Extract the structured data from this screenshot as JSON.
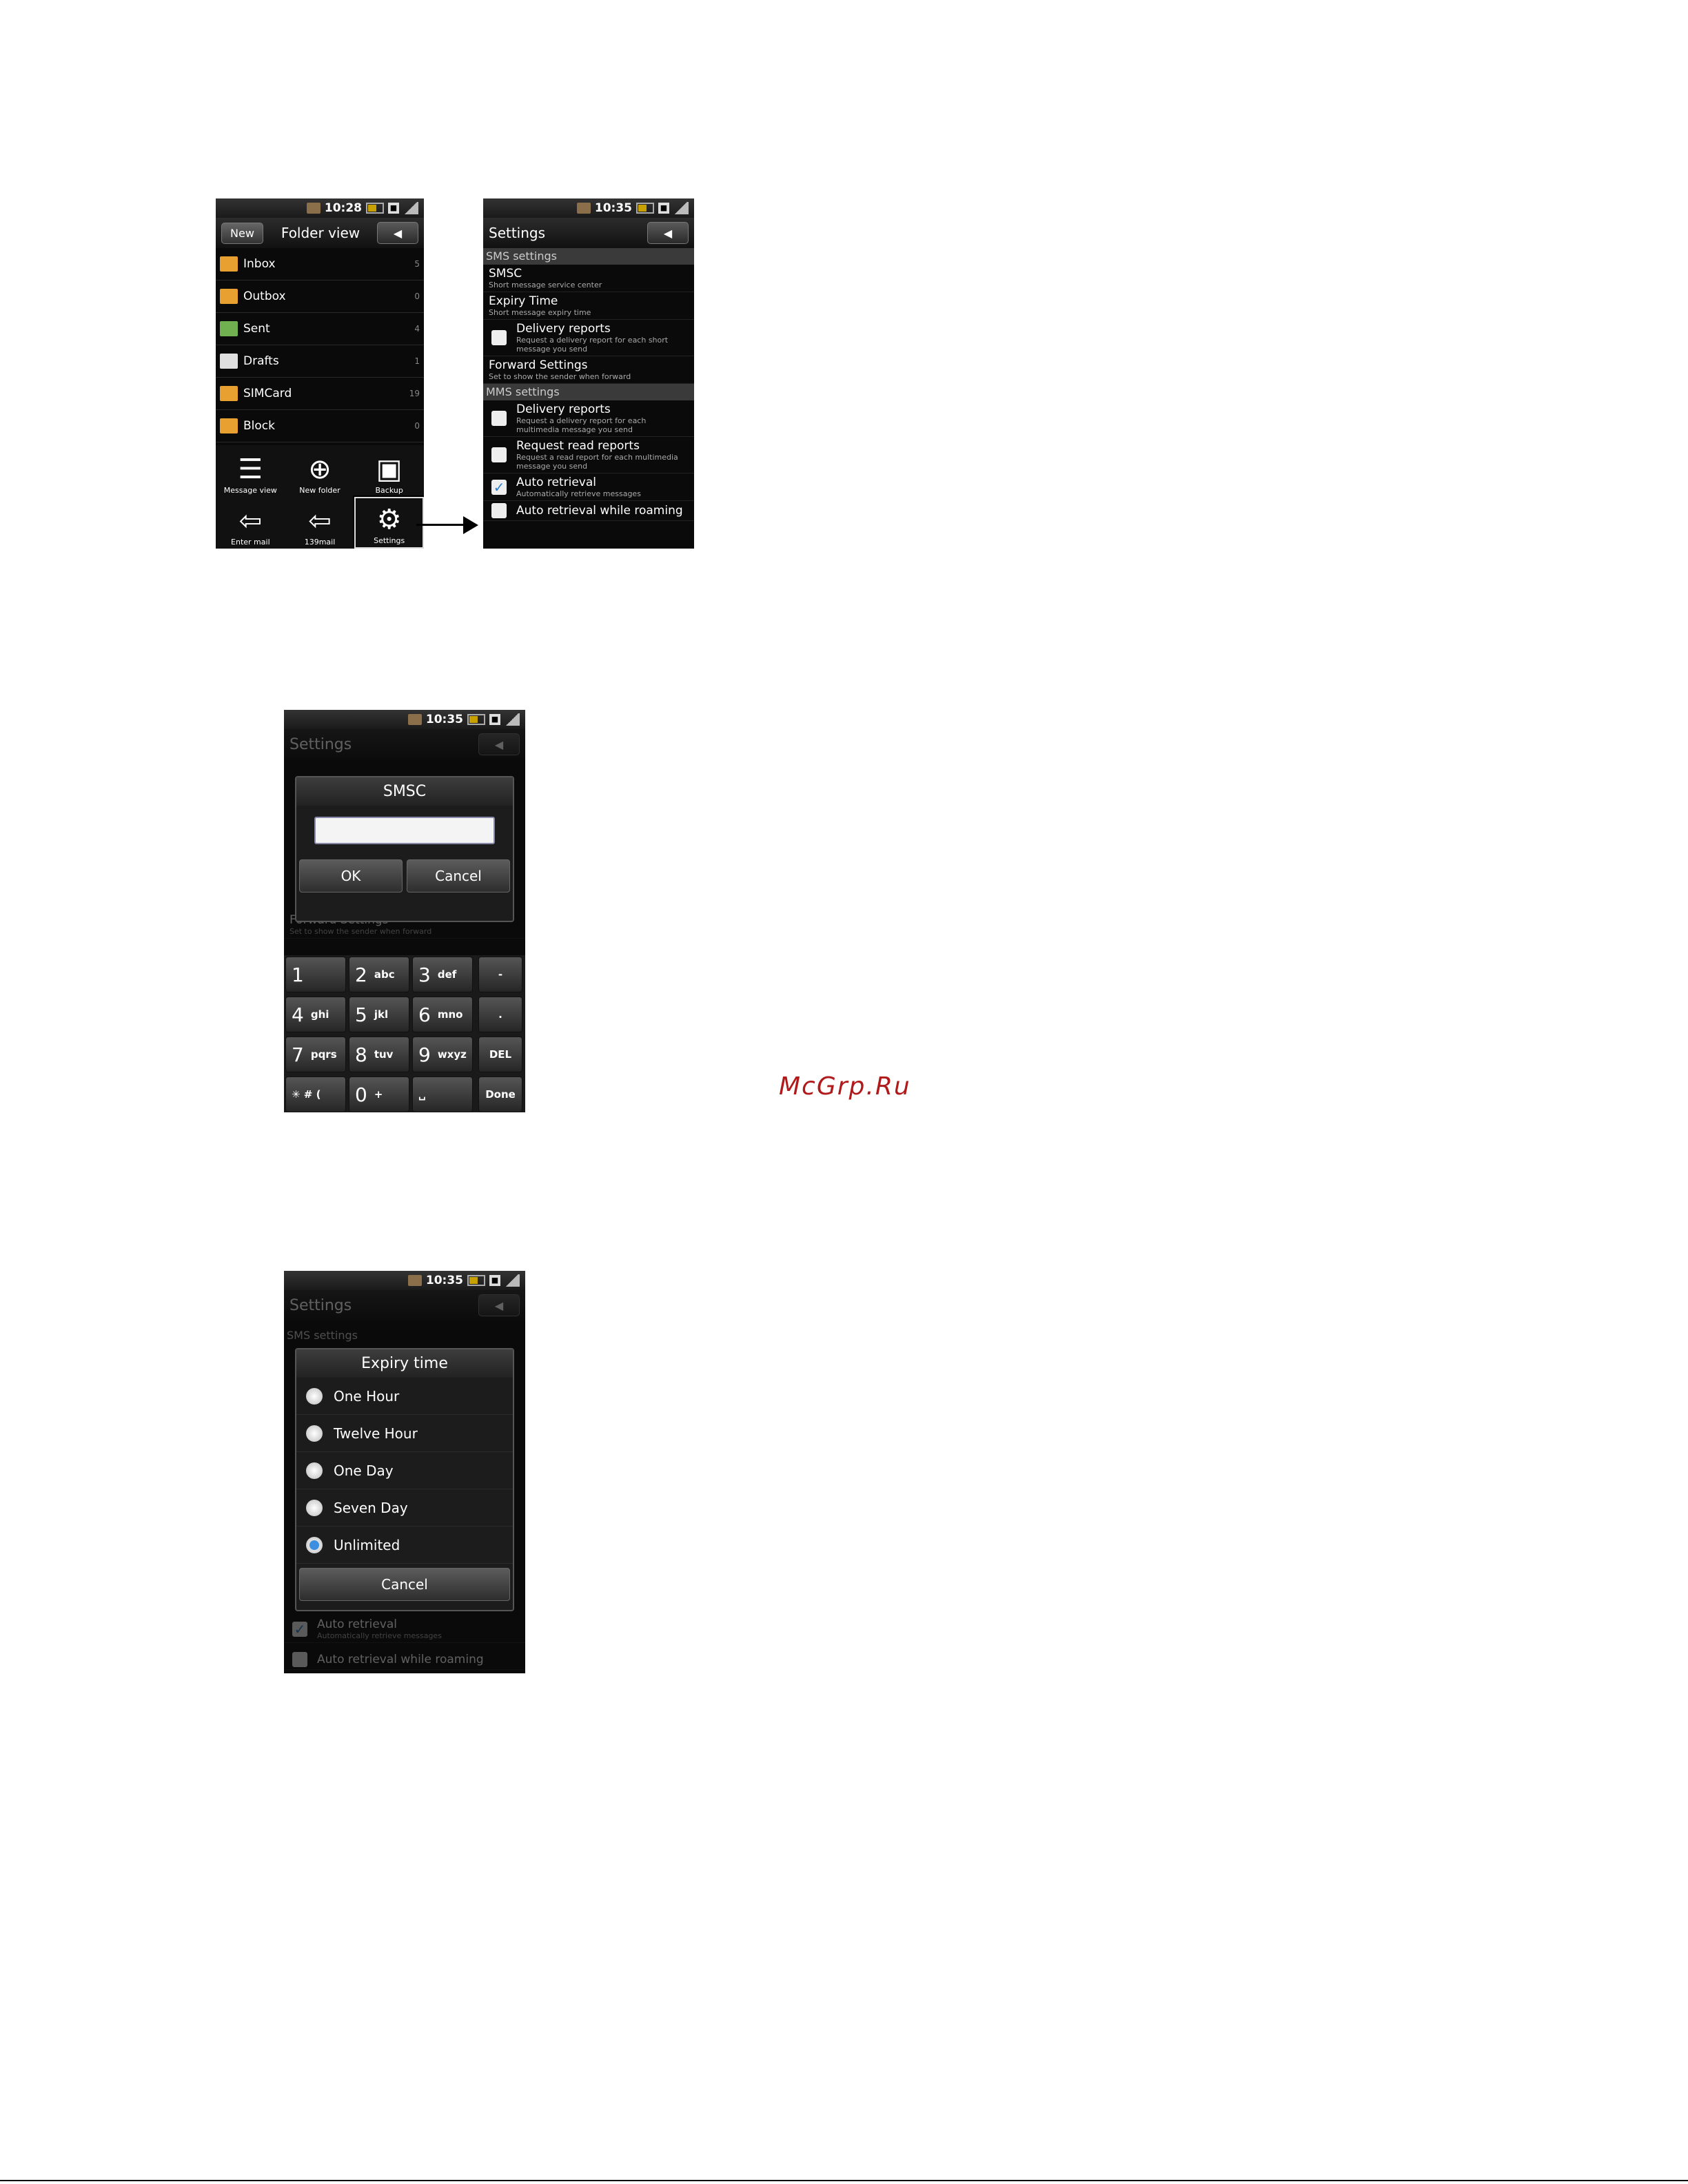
{
  "status_times": {
    "folder": "10:28",
    "settings": "10:35",
    "smsc": "10:35",
    "expiry": "10:35"
  },
  "folder_view": {
    "new_button": "New",
    "title": "Folder view",
    "folders": [
      {
        "name": "Inbox",
        "count": "5",
        "color": "#e8a030"
      },
      {
        "name": "Outbox",
        "count": "0",
        "color": "#e8a030"
      },
      {
        "name": "Sent",
        "count": "4",
        "color": "#70b050"
      },
      {
        "name": "Drafts",
        "count": "1",
        "color": "#e0e0e0"
      },
      {
        "name": "SIMCard",
        "count": "19",
        "color": "#e8a030"
      },
      {
        "name": "Block",
        "count": "0",
        "color": "#e8a030"
      }
    ],
    "menu": [
      {
        "label": "Message view",
        "icon": "list-icon"
      },
      {
        "label": "New folder",
        "icon": "plus-icon"
      },
      {
        "label": "Backup",
        "icon": "save-icon"
      },
      {
        "label": "Enter mail",
        "icon": "mail-enter-icon"
      },
      {
        "label": "139mail",
        "icon": "mail-enter-icon"
      },
      {
        "label": "Settings",
        "icon": "gear-icon"
      }
    ]
  },
  "settings": {
    "title": "Settings",
    "sms_header": "SMS settings",
    "smsc_title": "SMSC",
    "smsc_sub": "Short message service center",
    "expiry_title": "Expiry Time",
    "expiry_sub": "Short message expiry time",
    "sms_delivery_title": "Delivery reports",
    "sms_delivery_sub": "Request a delivery report for each short message you send",
    "forward_title": "Forward Settings",
    "forward_sub": "Set to show the sender when forward",
    "mms_header": "MMS settings",
    "mms_delivery_title": "Delivery reports",
    "mms_delivery_sub": "Request a delivery report for each multimedia message you send",
    "read_title": "Request read reports",
    "read_sub": "Request a read report for each multimedia message you send",
    "auto_title": "Auto retrieval",
    "auto_sub": "Automatically retrieve messages",
    "roaming_title": "Auto retrieval while roaming"
  },
  "smsc_dialog": {
    "title": "SMSC",
    "input_value": "",
    "ok": "OK",
    "cancel": "Cancel"
  },
  "keypad": {
    "rows": [
      [
        {
          "n": "1",
          "l": ""
        },
        {
          "n": "2",
          "l": "abc"
        },
        {
          "n": "3",
          "l": "def"
        },
        {
          "n": "",
          "l": "-"
        }
      ],
      [
        {
          "n": "4",
          "l": "ghi"
        },
        {
          "n": "5",
          "l": "jkl"
        },
        {
          "n": "6",
          "l": "mno"
        },
        {
          "n": "",
          "l": "."
        }
      ],
      [
        {
          "n": "7",
          "l": "pqrs"
        },
        {
          "n": "8",
          "l": "tuv"
        },
        {
          "n": "9",
          "l": "wxyz"
        },
        {
          "n": "",
          "l": "DEL"
        }
      ],
      [
        {
          "n": "",
          "l": "✳ # ("
        },
        {
          "n": "0",
          "l": "+"
        },
        {
          "n": "",
          "l": "␣"
        },
        {
          "n": "",
          "l": "Done"
        }
      ]
    ]
  },
  "expiry_dialog": {
    "title": "Expiry time",
    "options": [
      {
        "label": "One Hour",
        "selected": false
      },
      {
        "label": "Twelve Hour",
        "selected": false
      },
      {
        "label": "One Day",
        "selected": false
      },
      {
        "label": "Seven Day",
        "selected": false
      },
      {
        "label": "Unlimited",
        "selected": true
      }
    ],
    "cancel": "Cancel"
  },
  "watermark": "McGrp.Ru"
}
